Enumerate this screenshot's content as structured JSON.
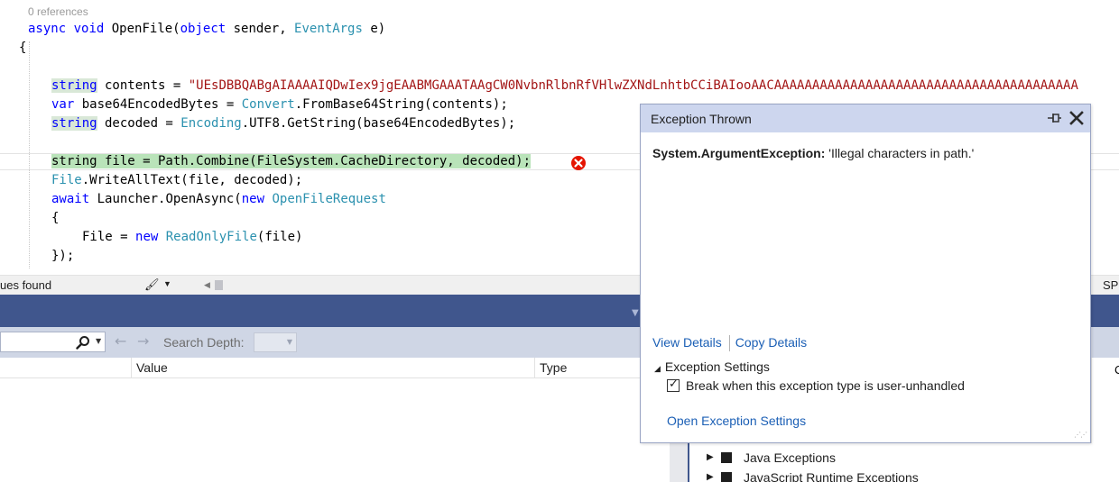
{
  "editor": {
    "codelens": "0 references",
    "lines": {
      "sig_async": "async",
      "sig_void": "void",
      "sig_name": " OpenFile(",
      "sig_object": "object",
      "sig_sender": " sender, ",
      "sig_eventargs": "EventArgs",
      "sig_end": " e)",
      "brace_open": "{",
      "l1_kw": "string",
      "l1_mid": " contents = ",
      "l1_str": "\"UEsDBBQABgAIAAAAIQDwIex9jgEAABMGAAATAAgCW0NvbnRlbnRfVHlwZXNdLnhtbCCiBAIooAACAAAAAAAAAAAAAAAAAAAAAAAAAAAAAAAAAAAAAAAA",
      "l2_kw": "var",
      "l2_mid": " base64EncodedBytes = ",
      "l2_ty": "Convert",
      "l2_end": ".FromBase64String(contents);",
      "l3_kw": "string",
      "l3_mid": " decoded = ",
      "l3_ty": "Encoding",
      "l3_end": ".UTF8.GetString(base64EncodedBytes);",
      "l4_stmt": "string file = Path.Combine(FileSystem.CacheDirectory, decoded);",
      "l5_ty": "File",
      "l5_end": ".WriteAllText(file, decoded);",
      "l6_kw": "await",
      "l6_ty": " Launcher",
      "l6_mid": ".OpenAsync(",
      "l6_new": "new",
      "l6_cls": " OpenFileRequest",
      "l7": "{",
      "l8_a": "File = ",
      "l8_new": "new",
      "l8_cls": " ReadOnlyFile",
      "l8_end": "(file)",
      "l9": "});"
    }
  },
  "status": {
    "issues": "ues found",
    "right": "SP"
  },
  "locals": {
    "search_depth_label": "Search Depth:",
    "columns": [
      "Value",
      "Type"
    ],
    "right_col": "C"
  },
  "exception_settings": {
    "rows": [
      "Java Exceptions",
      "JavaScript Runtime Exceptions"
    ]
  },
  "popup": {
    "title": "Exception Thrown",
    "exception_type": "System.ArgumentException:",
    "exception_message": " 'Illegal characters in path.'",
    "view_details": "View Details",
    "copy_details": "Copy Details",
    "settings_header": "Exception Settings",
    "checkbox_label": "Break when this exception type is user-unhandled",
    "checkbox_checked": true,
    "open_settings": "Open Exception Settings"
  },
  "colors": {
    "keyword": "#0000ff",
    "type": "#2b91af",
    "string": "#a31515",
    "current_statement": "#b9e3b9",
    "pane_header": "#40568d",
    "popup_title": "#cdd6ee",
    "link": "#1b5fb5",
    "error_icon": "#e51400"
  },
  "icons": [
    "error-icon",
    "pin-icon",
    "close-icon",
    "search-icon",
    "back-arrow-icon",
    "forward-arrow-icon",
    "brush-icon"
  ]
}
